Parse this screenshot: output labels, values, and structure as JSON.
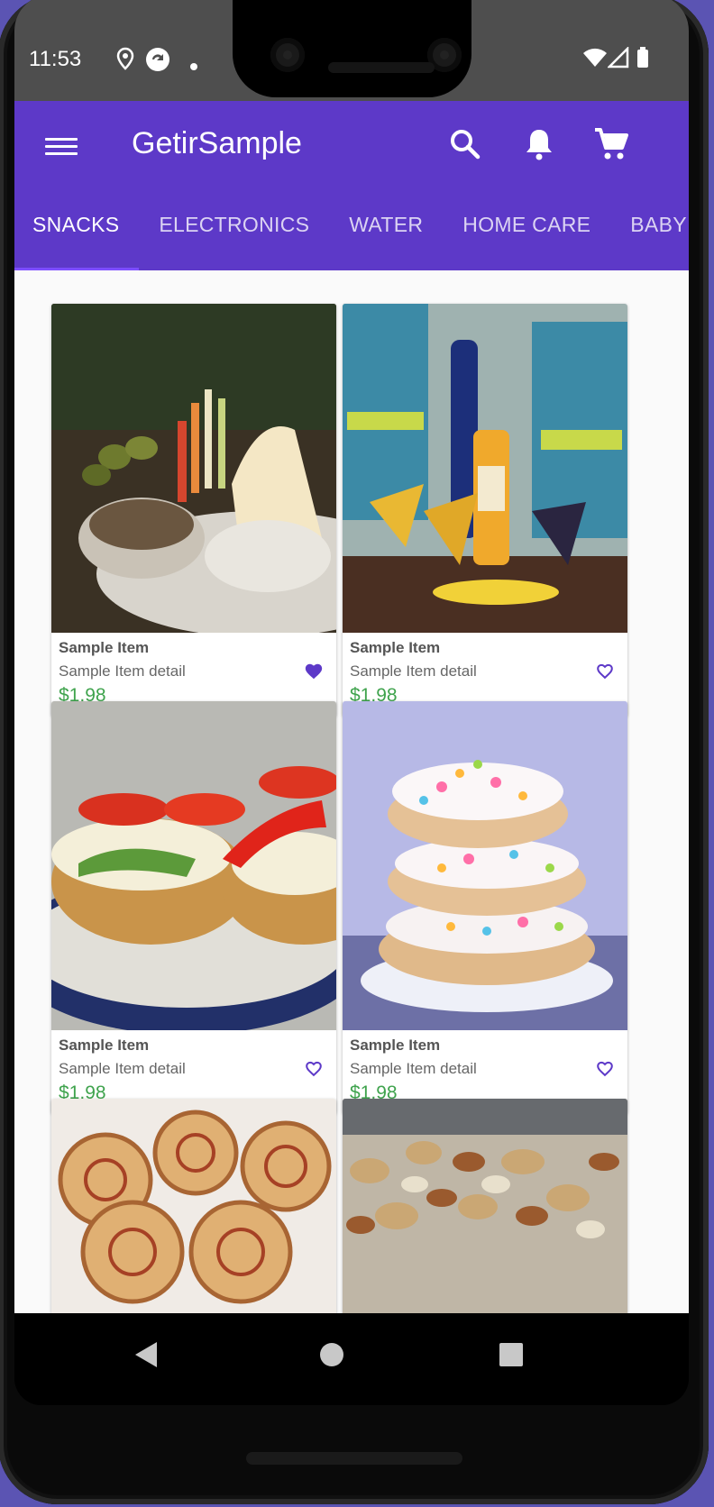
{
  "status_bar": {
    "time": "11:53"
  },
  "app_bar": {
    "title": "GetirSample"
  },
  "tabs": [
    {
      "label": "SNACKS",
      "active": true
    },
    {
      "label": "ELECTRONICS",
      "active": false
    },
    {
      "label": "WATER",
      "active": false
    },
    {
      "label": "HOME CARE",
      "active": false
    },
    {
      "label": "BABY",
      "active": false
    }
  ],
  "products": [
    {
      "name": "Sample Item",
      "detail": "Sample Item detail",
      "price": "$1,98",
      "favorite": true,
      "image": "snack-platter-photo"
    },
    {
      "name": "Sample Item",
      "detail": "Sample Item detail",
      "price": "$1,98",
      "favorite": false,
      "image": "tostitos-chips-photo"
    },
    {
      "name": "Sample Item",
      "detail": "Sample Item detail",
      "price": "$1,98",
      "favorite": false,
      "image": "bagel-sandwich-photo"
    },
    {
      "name": "Sample Item",
      "detail": "Sample Item detail",
      "price": "$1,98",
      "favorite": false,
      "image": "stacked-donuts-photo"
    },
    {
      "name": "",
      "detail": "",
      "price": "",
      "favorite": false,
      "image": "pinwheel-pastry-photo"
    },
    {
      "name": "",
      "detail": "",
      "price": "",
      "favorite": false,
      "image": "mixed-nuts-photo"
    }
  ],
  "colors": {
    "primary": "#5d39c8",
    "tab_indicator": "#7c4dff",
    "price": "#3fa34d",
    "heart": "#5d39c8"
  }
}
